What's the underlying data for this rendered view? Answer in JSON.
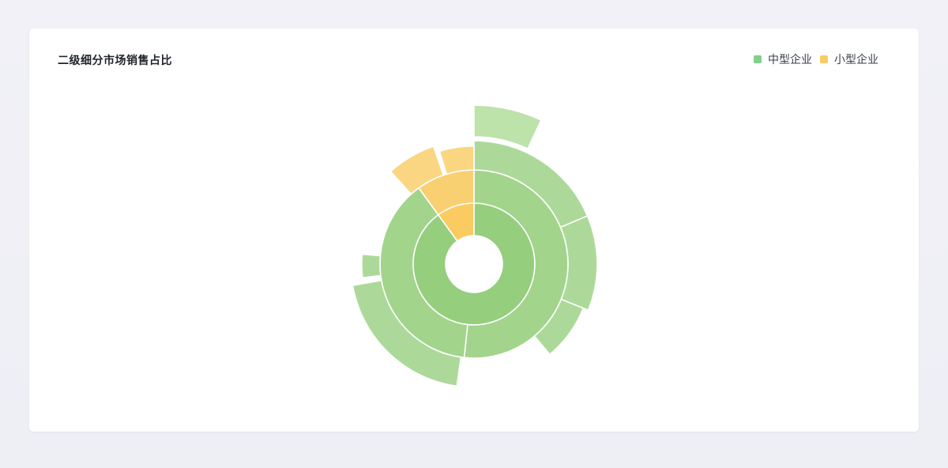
{
  "chart_data": {
    "type": "sunburst",
    "title": "二级细分市场销售占比",
    "legend": [
      {
        "name": "中型企业",
        "color": "#7fd18c"
      },
      {
        "name": "小型企业",
        "color": "#fbcb62"
      }
    ],
    "legend_position": "top-right",
    "rings": [
      {
        "level": 1,
        "segments": [
          {
            "series": "中型企业",
            "start_deg": 0,
            "end_deg": 324,
            "color": "#95ce7d"
          },
          {
            "series": "小型企业",
            "start_deg": 324,
            "end_deg": 360,
            "color": "#f9cb61"
          }
        ]
      },
      {
        "level": 2,
        "segments": [
          {
            "series": "中型企业",
            "start_deg": 0,
            "end_deg": 186,
            "color": "#a2d48c"
          },
          {
            "series": "中型企业",
            "start_deg": 186,
            "end_deg": 324,
            "color": "#a2d48c"
          },
          {
            "series": "小型企业",
            "start_deg": 324,
            "end_deg": 360,
            "color": "#f9d071"
          }
        ]
      },
      {
        "level": 3,
        "segments": [
          {
            "series": "中型企业",
            "start_deg": 0,
            "end_deg": 67,
            "color": "#acd999",
            "extent": 0.88
          },
          {
            "series": "中型企业",
            "start_deg": 67,
            "end_deg": 112,
            "color": "#acd999",
            "extent": 0.88
          },
          {
            "series": "中型企业",
            "start_deg": 112,
            "end_deg": 140,
            "color": "#acd999",
            "extent": 0.72
          },
          {
            "series": "中型企业",
            "start_deg": 188,
            "end_deg": 260,
            "color": "#acd999",
            "extent": 0.88
          },
          {
            "series": "中型企业",
            "start_deg": 263,
            "end_deg": 275,
            "color": "#acd999",
            "extent": 0.55
          },
          {
            "series": "小型企业",
            "start_deg": 318,
            "end_deg": 341,
            "color": "#fad682",
            "extent": 0.92
          },
          {
            "series": "小型企业",
            "start_deg": 343,
            "end_deg": 360,
            "color": "#fad682",
            "extent": 0.72
          }
        ]
      },
      {
        "level": 4,
        "segments": [
          {
            "series": "中型企业",
            "start_deg": 0,
            "end_deg": 25,
            "color": "#bde2aa",
            "extent": 0.95
          }
        ]
      }
    ]
  }
}
